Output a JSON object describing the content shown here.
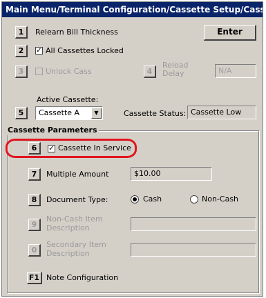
{
  "window": {
    "title": "Main Menu/Terminal Configuration/Cassette Setup/Cassette P..."
  },
  "rows": {
    "relearn": {
      "key": "1",
      "label": "Relearn Bill Thickness"
    },
    "enter_label": "Enter",
    "locked": {
      "key": "2",
      "label": "All Cassettes Locked",
      "checked": true
    },
    "unlock": {
      "key": "3",
      "label": "Unlock Cass",
      "checked": false
    },
    "reload": {
      "key": "4",
      "label": "Reload Delay",
      "value": "N/A"
    },
    "active": {
      "key": "5",
      "label": "Active Cassette:",
      "value": "Cassette A"
    },
    "status": {
      "label": "Cassette Status:",
      "value": "Cassette Low"
    }
  },
  "params": {
    "group_label": "Cassette Parameters",
    "in_service": {
      "key": "6",
      "label": "Cassette In Service",
      "checked": true
    },
    "multiple": {
      "key": "7",
      "label": "Multiple Amount",
      "value": "$10.00"
    },
    "doc_type": {
      "key": "8",
      "label": "Document Type:",
      "options": [
        "Cash",
        "Non-Cash"
      ],
      "selected": "Cash"
    },
    "non_cash": {
      "key": "9",
      "label_line1": "Non-Cash Item",
      "label_line2": "Description",
      "value": ""
    },
    "secondary": {
      "key": "0",
      "label_line1": "Secondary Item",
      "label_line2": "Description",
      "value": ""
    },
    "note_config": {
      "key": "F1",
      "label": "Note Configuration"
    }
  },
  "colors": {
    "titlebar": "#0a246a",
    "highlight": "#e0141e",
    "face": "#d4d0c8"
  }
}
